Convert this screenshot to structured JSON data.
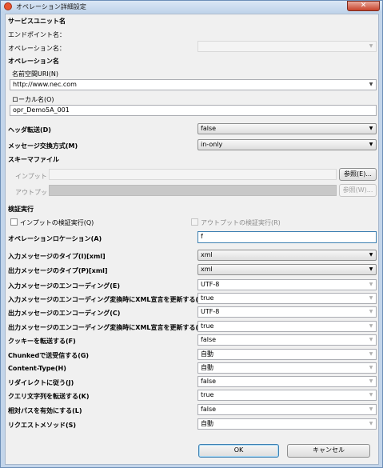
{
  "window": {
    "title": "オペレーション詳細設定",
    "close_glyph": "✕"
  },
  "service": {
    "header": "サービスユニット名",
    "endpoint_label": "エンドポイント名：",
    "operation_label": "オペレーション名："
  },
  "opname": {
    "header": "オペレーション名",
    "namespace_label": "名前空間URI(N)",
    "namespace_value": "http://www.nec.com",
    "local_label": "ローカル名(O)",
    "local_value": "opr_Demo5A_001"
  },
  "header_transfer": {
    "label": "ヘッダ転送(D)",
    "value": "false"
  },
  "message_exchange": {
    "label": "メッセージ交換方式(M)",
    "value": "in-only"
  },
  "schema": {
    "header": "スキーマファイル",
    "input_label": "インプット",
    "output_label": "アウトプット",
    "browse_input": "参照(E)...",
    "browse_output": "参照(W)..."
  },
  "validation": {
    "header": "検証実行",
    "input_check": "インプットの検証実行(Q)",
    "output_check": "アウトプットの検証実行(R)"
  },
  "location": {
    "label": "オペレーションロケーション(A)",
    "value": "f"
  },
  "settings": [
    {
      "label": "入力メッセージのタイプ(I)[xml]",
      "value": "xml"
    },
    {
      "label": "出力メッセージのタイプ(P)[xml]",
      "value": "xml"
    },
    {
      "label": "入力メッセージのエンコーディング(E)",
      "value": "UTF-8"
    },
    {
      "label": "入力メッセージのエンコーディング変換時にXML宣言を更新する(U)",
      "value": "true"
    },
    {
      "label": "出力メッセージのエンコーディング(C)",
      "value": "UTF-8"
    },
    {
      "label": "出力メッセージのエンコーディング変換時にXML宣言を更新する(T)",
      "value": "true"
    },
    {
      "label": "クッキーを転送する(F)",
      "value": "false"
    },
    {
      "label": "Chunkedで送受信する(G)",
      "value": "自動"
    },
    {
      "label": "Content-Type(H)",
      "value": "自動"
    },
    {
      "label": "リダイレクトに従う(J)",
      "value": "false"
    },
    {
      "label": "クエリ文字列を転送する(K)",
      "value": "true"
    },
    {
      "label": "相対パスを有効にする(L)",
      "value": "false"
    },
    {
      "label": "リクエストメソッド(S)",
      "value": "自動"
    }
  ],
  "buttons": {
    "ok": "OK",
    "cancel": "キャンセル"
  },
  "icons": {
    "dropdown": "chevron-down-icon",
    "app": "app-icon",
    "close": "close-icon"
  },
  "colors": {
    "accent": "#3c7fb1",
    "frame": "#c3d5ea",
    "close": "#c7432b"
  }
}
